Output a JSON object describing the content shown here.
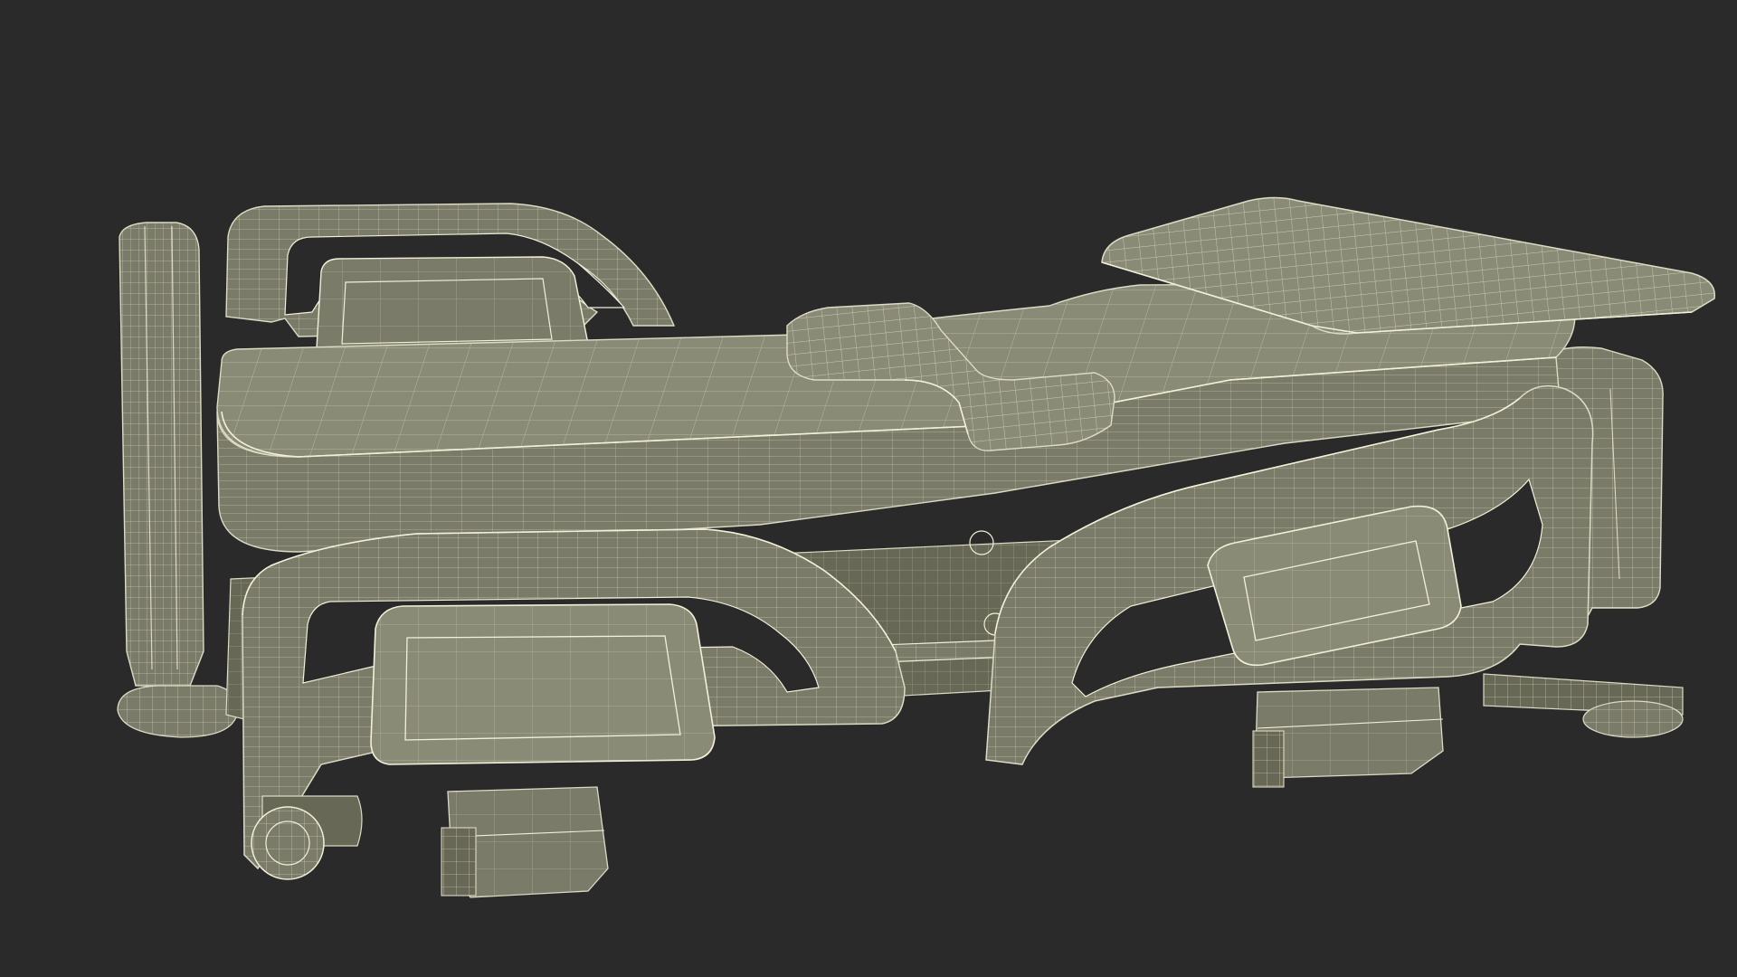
{
  "scene": {
    "background": "#2a2a2a",
    "mesh_fill": "#7a7b68",
    "mesh_fill_dark": "#676856",
    "mesh_fill_light": "#8a8b76",
    "wire_color": "#dcdbc4",
    "edge_color": "#f2f0d8"
  }
}
